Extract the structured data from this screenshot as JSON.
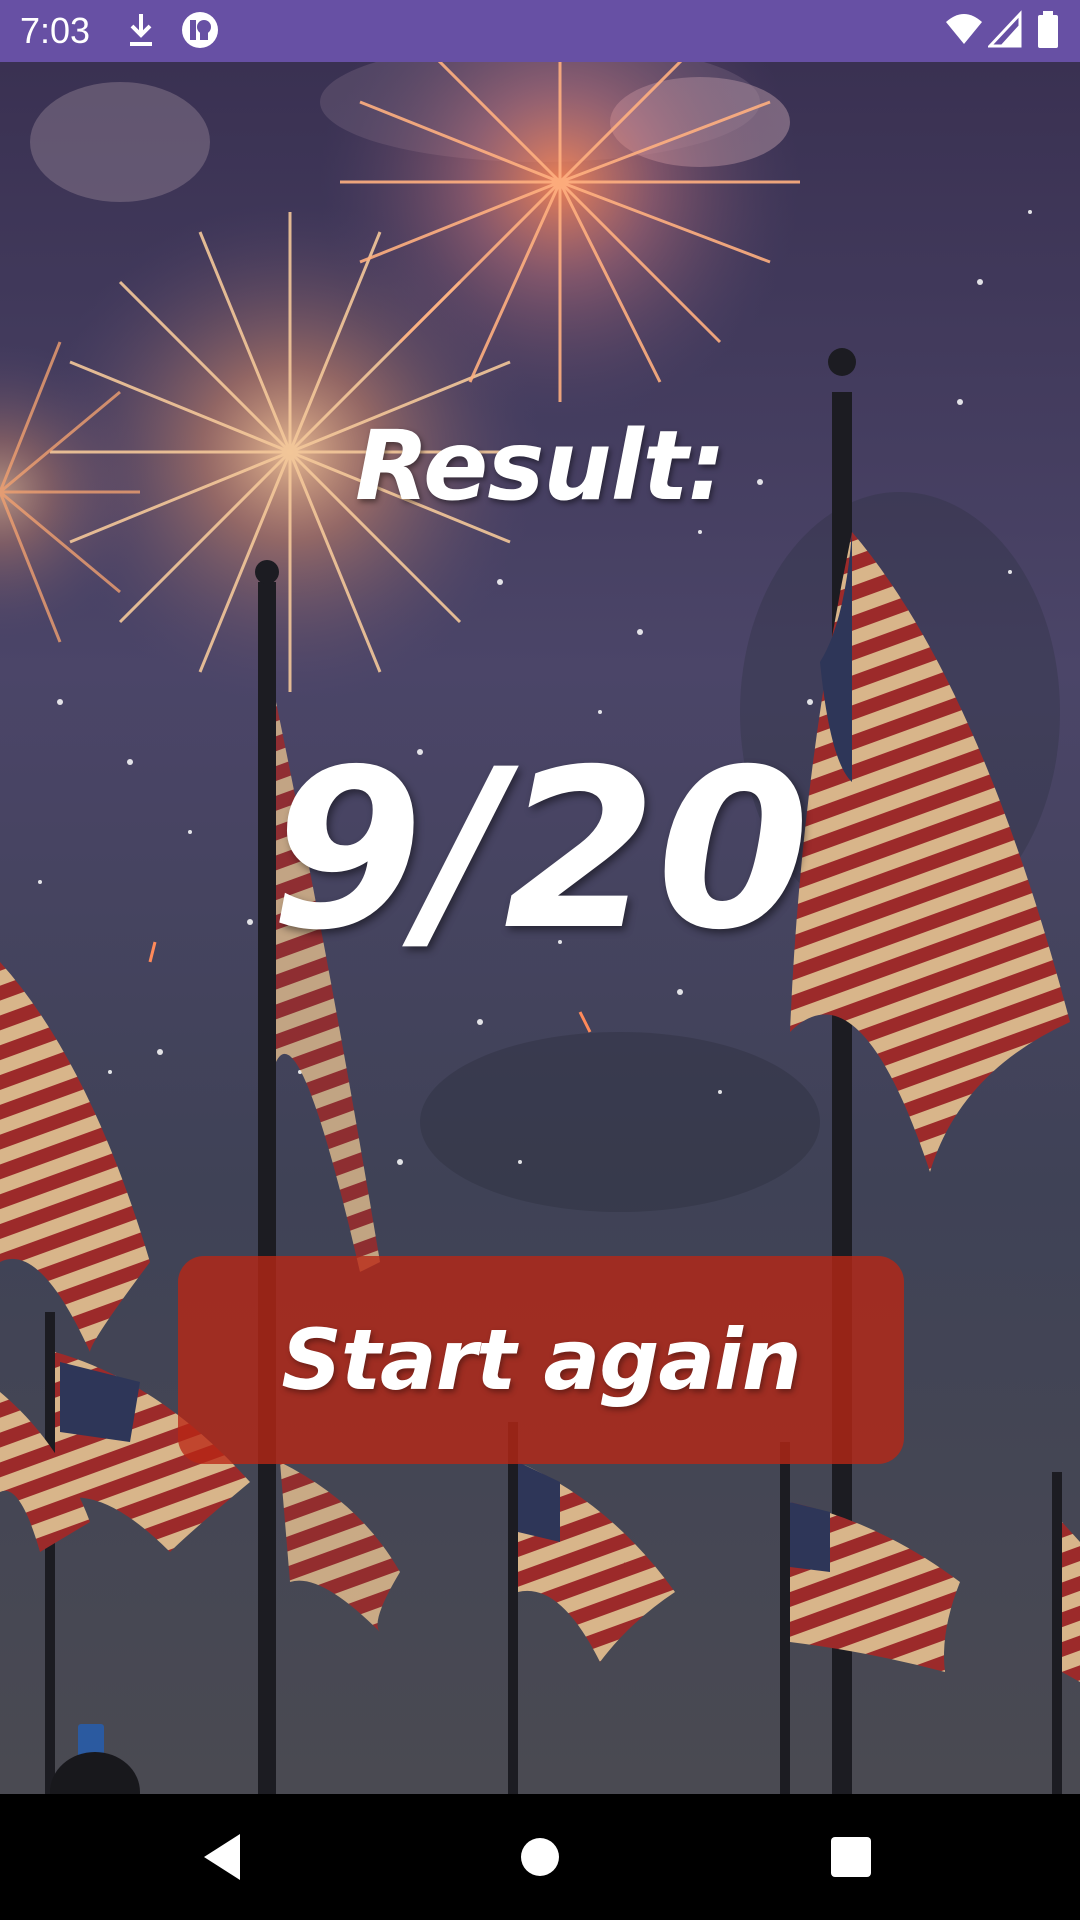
{
  "status_bar": {
    "time": "7:03",
    "background_color": "#6750A4",
    "left_icons": [
      "download-icon",
      "notification-app-icon"
    ],
    "right_icons": [
      "wifi-icon",
      "signal-icon",
      "battery-icon"
    ]
  },
  "background": {
    "description_icon": "fireworks-flags-image"
  },
  "result": {
    "label": "Result:",
    "score": "9/20"
  },
  "actions": {
    "start_again_label": "Start again",
    "button_color": "#BA2614"
  },
  "nav_bar": {
    "buttons": [
      "back-icon",
      "home-icon",
      "recents-icon"
    ]
  }
}
